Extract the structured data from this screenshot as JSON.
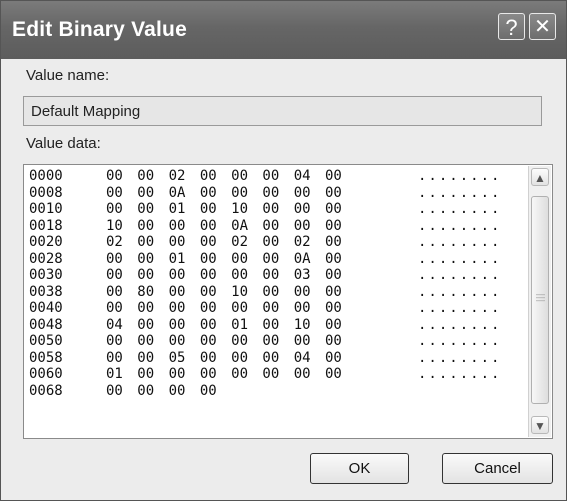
{
  "window": {
    "title": "Edit Binary Value"
  },
  "title_buttons": {
    "help": "?",
    "close": "✕"
  },
  "value_name": {
    "label": "Value name:",
    "value": "Default Mapping"
  },
  "value_data": {
    "label": "Value data:",
    "rows": [
      {
        "offset": "0000",
        "bytes": "00 00 02 00 00 00 04 00",
        "ascii": "........"
      },
      {
        "offset": "0008",
        "bytes": "00 00 0A 00 00 00 00 00",
        "ascii": "........"
      },
      {
        "offset": "0010",
        "bytes": "00 00 01 00 10 00 00 00",
        "ascii": "........"
      },
      {
        "offset": "0018",
        "bytes": "10 00 00 00 0A 00 00 00",
        "ascii": "........"
      },
      {
        "offset": "0020",
        "bytes": "02 00 00 00 02 00 02 00",
        "ascii": "........"
      },
      {
        "offset": "0028",
        "bytes": "00 00 01 00 00 00 0A 00",
        "ascii": "........"
      },
      {
        "offset": "0030",
        "bytes": "00 00 00 00 00 00 03 00",
        "ascii": "........"
      },
      {
        "offset": "0038",
        "bytes": "00 80 00 00 10 00 00 00",
        "ascii": "........"
      },
      {
        "offset": "0040",
        "bytes": "00 00 00 00 00 00 00 00",
        "ascii": "........"
      },
      {
        "offset": "0048",
        "bytes": "04 00 00 00 01 00 10 00",
        "ascii": "........"
      },
      {
        "offset": "0050",
        "bytes": "00 00 00 00 00 00 00 00",
        "ascii": "........"
      },
      {
        "offset": "0058",
        "bytes": "00 00 05 00 00 00 04 00",
        "ascii": "........"
      },
      {
        "offset": "0060",
        "bytes": "01 00 00 00 00 00 00 00",
        "ascii": "........"
      },
      {
        "offset": "0068",
        "bytes": "00 00 00 00",
        "ascii": ""
      }
    ]
  },
  "buttons": {
    "ok": "OK",
    "cancel": "Cancel"
  },
  "icons": {
    "scroll_up": "chevron-up-icon",
    "scroll_down": "chevron-down-icon",
    "thumb_grip": "grip-icon"
  },
  "colors": {
    "titlebar": "#666666",
    "dialog_bg": "#ececec"
  }
}
